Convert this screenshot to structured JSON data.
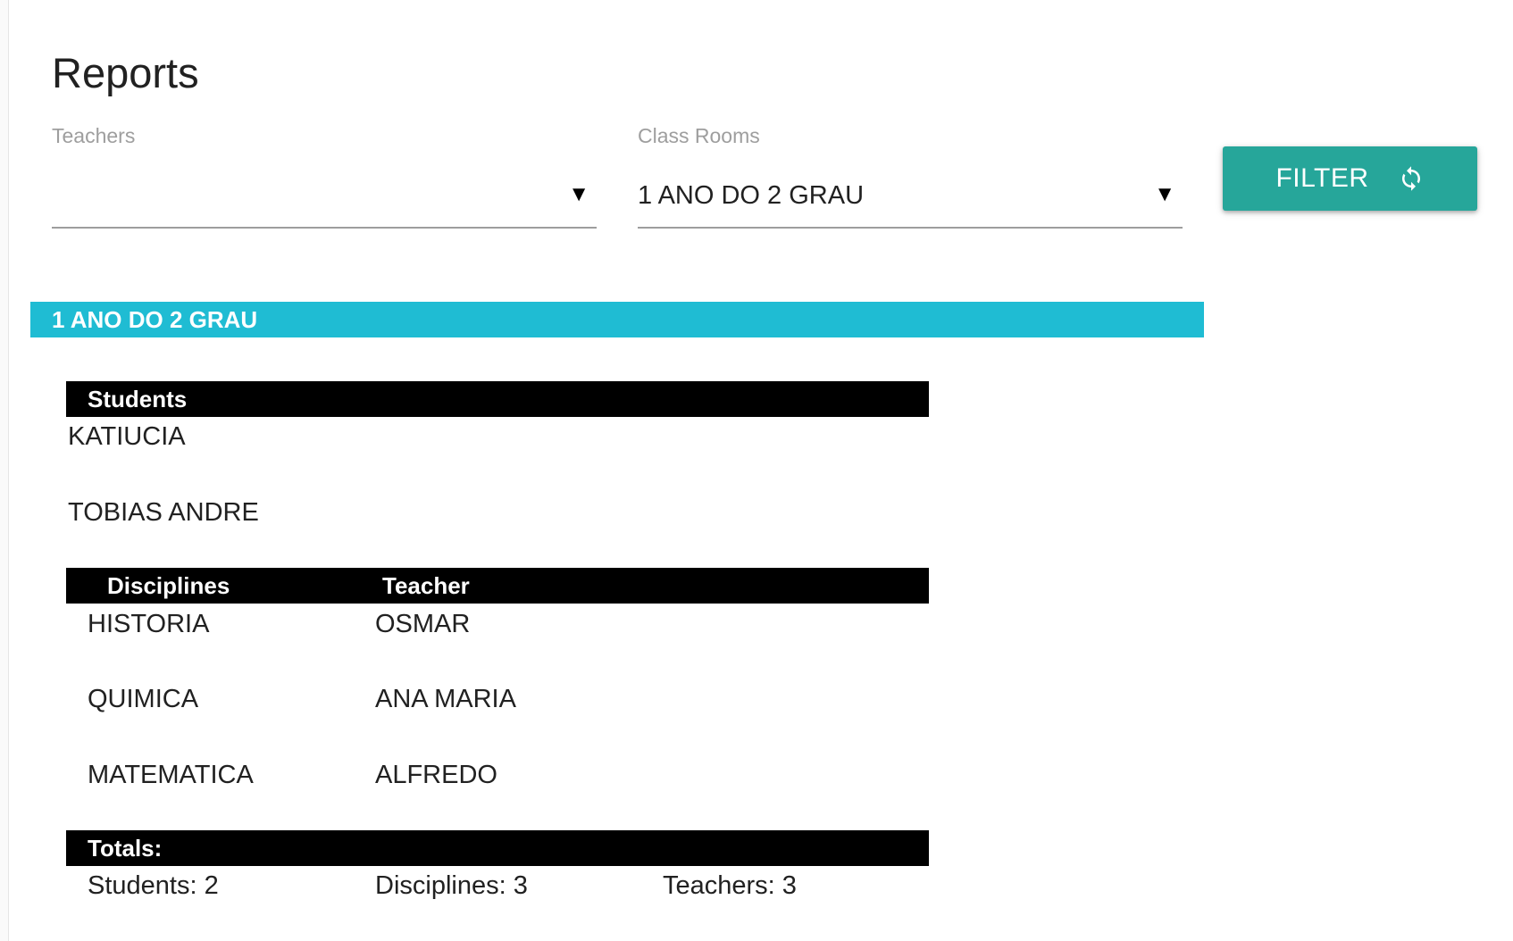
{
  "page": {
    "title": "Reports"
  },
  "filters": {
    "teachers": {
      "label": "Teachers",
      "value": ""
    },
    "class_rooms": {
      "label": "Class Rooms",
      "value": "1 ANO DO 2 GRAU"
    },
    "dropdown_icon": "triangle-down-icon",
    "filter_button": {
      "label": "FILTER",
      "icon": "refresh-icon",
      "color": "#26a69a"
    }
  },
  "report": {
    "class_title": "1 ANO DO 2 GRAU",
    "header_color": "#1fbcd3",
    "students_header": "Students",
    "students": [
      "KATIUCIA",
      "TOBIAS ANDRE"
    ],
    "disciplines_header": "Disciplines",
    "teacher_header": "Teacher",
    "disciplines": [
      {
        "discipline": "HISTORIA",
        "teacher": "OSMAR"
      },
      {
        "discipline": "QUIMICA",
        "teacher": "ANA MARIA"
      },
      {
        "discipline": "MATEMATICA",
        "teacher": "ALFREDO"
      }
    ],
    "totals_header": "Totals:",
    "totals": {
      "students": "Students: 2",
      "disciplines": "Disciplines: 3",
      "teachers": "Teachers: 3"
    }
  }
}
